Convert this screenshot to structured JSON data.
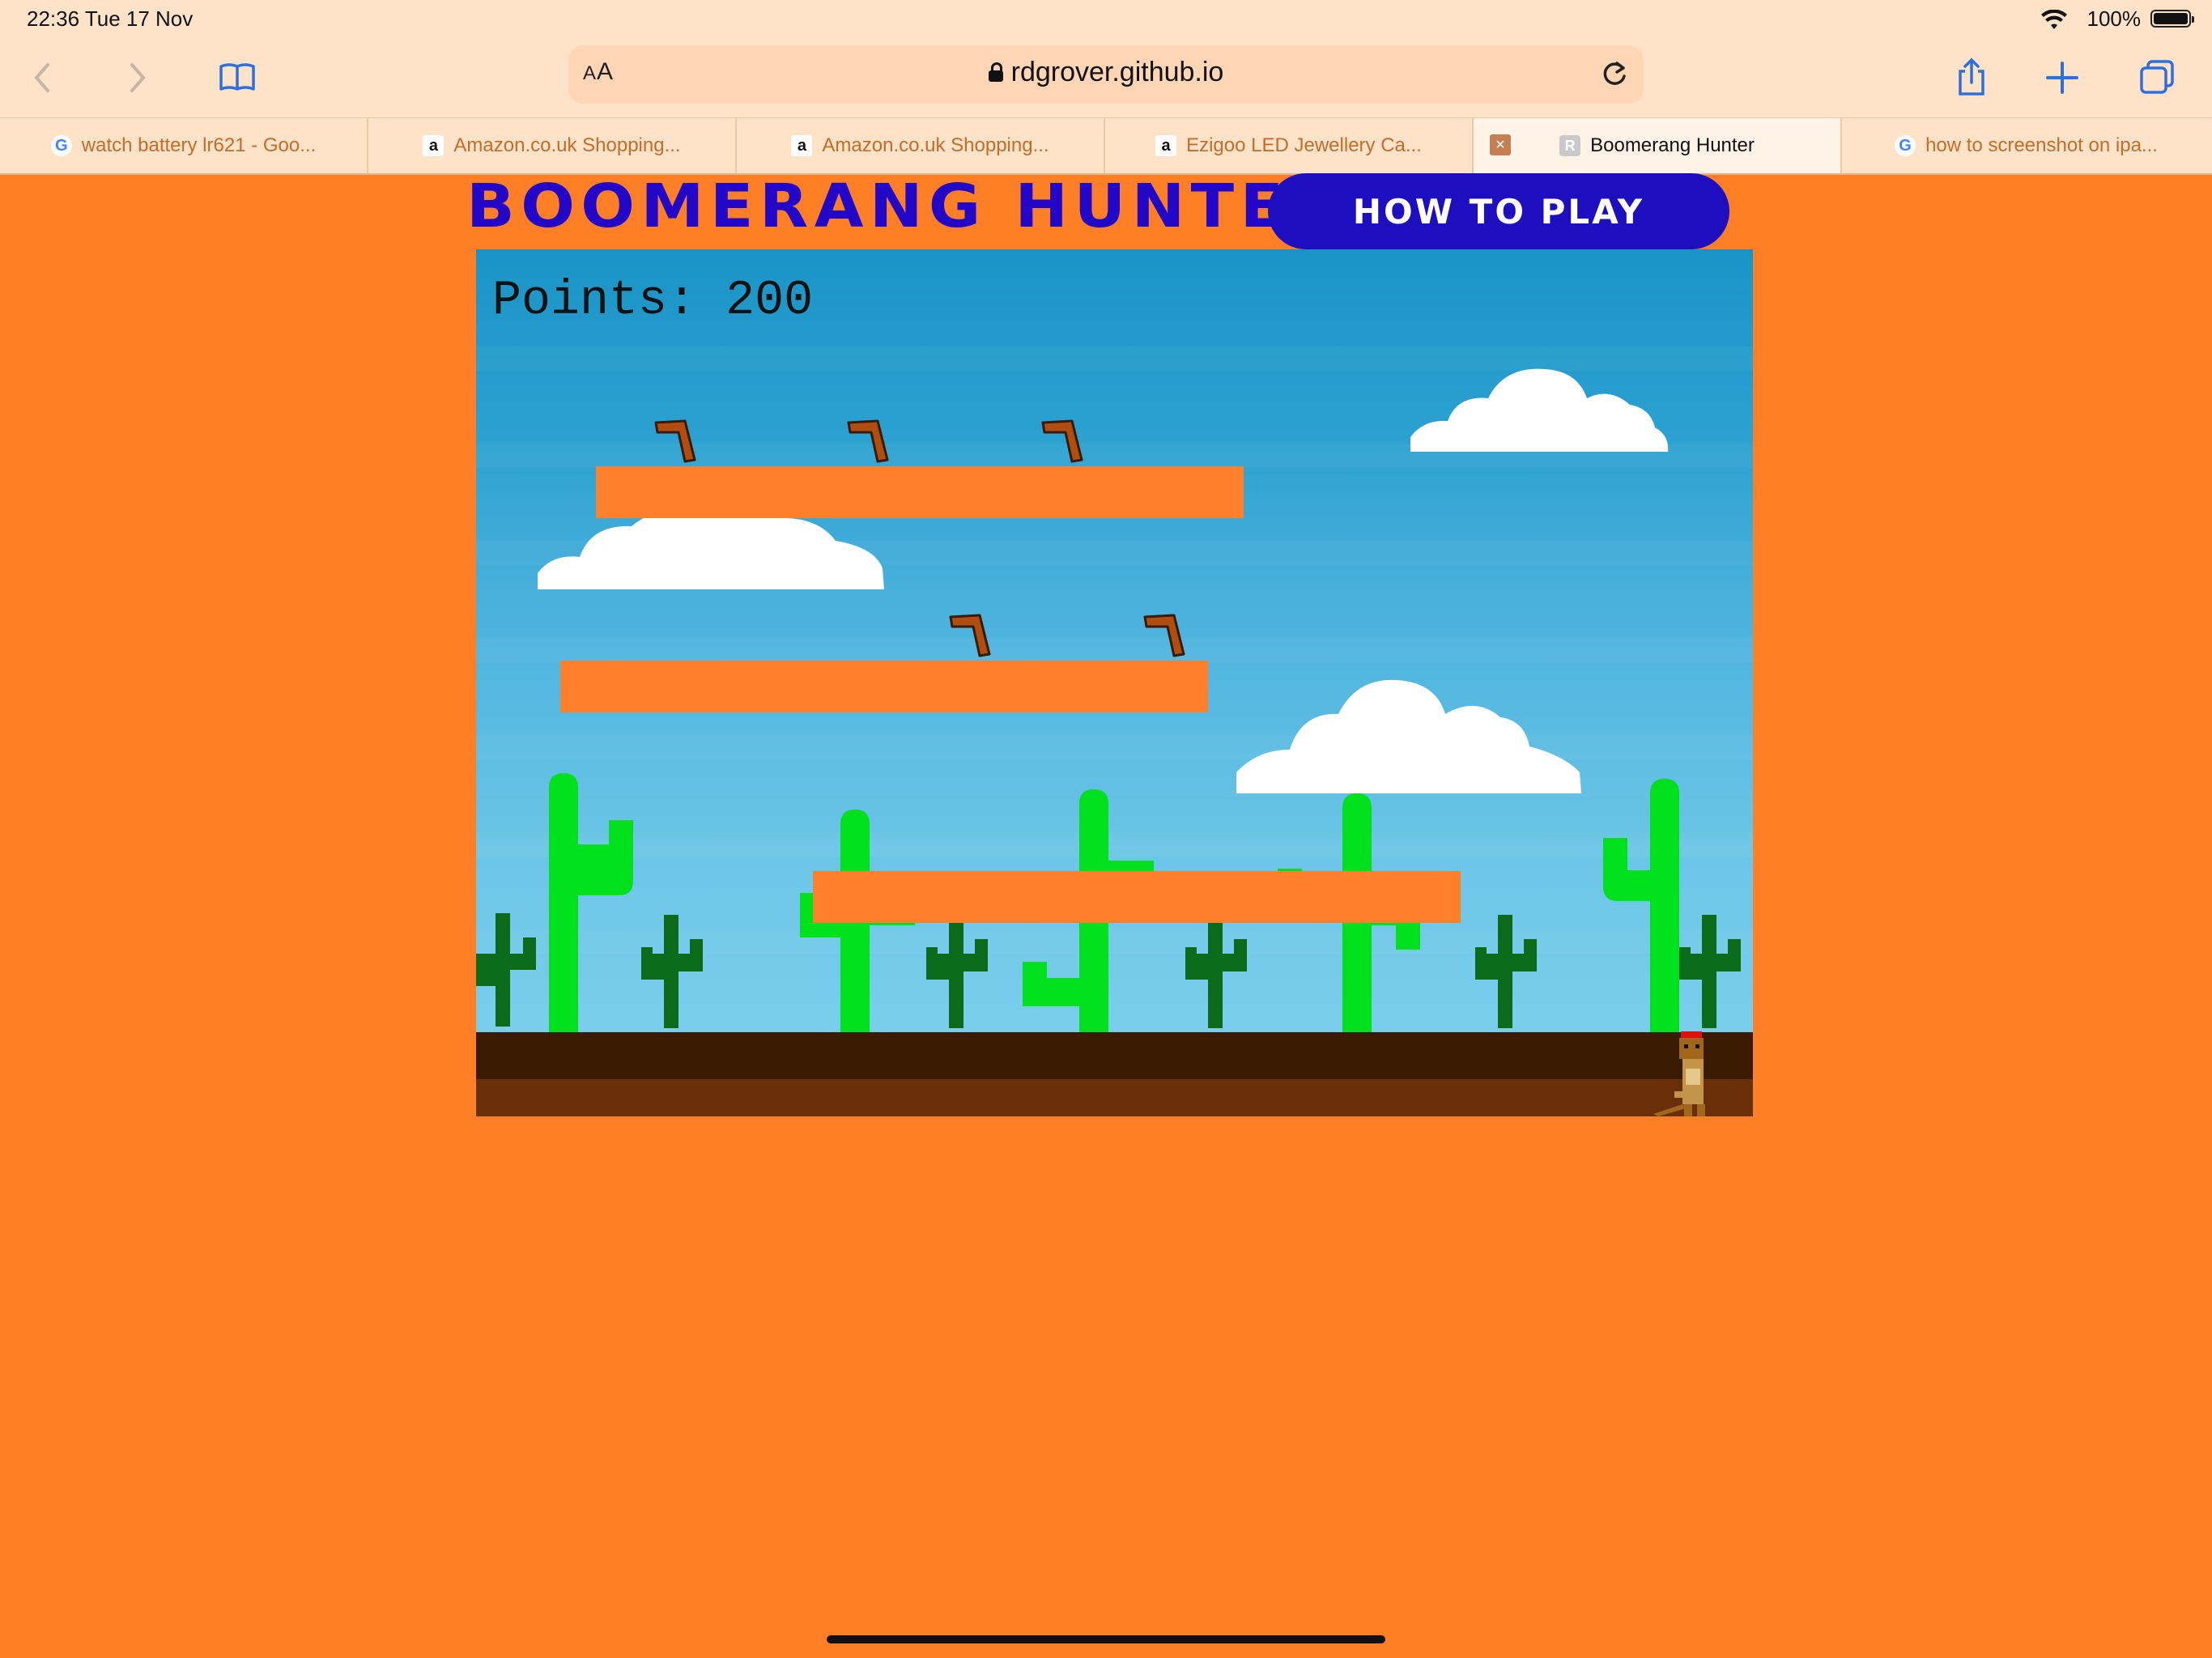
{
  "status_bar": {
    "time": "22:36   Tue 17 Nov",
    "battery": "100%"
  },
  "browser": {
    "text_size_label": "AA",
    "host": "rdgrover.github.io",
    "tabs": [
      {
        "title": "watch battery lr621 - Goo...",
        "favicon": "G"
      },
      {
        "title": "Amazon.co.uk Shopping...",
        "favicon": "a"
      },
      {
        "title": "Amazon.co.uk Shopping...",
        "favicon": "a"
      },
      {
        "title": "Ezigoo LED Jewellery Ca...",
        "favicon": "a"
      },
      {
        "title": "Boomerang Hunter",
        "favicon": "R",
        "active": true
      },
      {
        "title": "how to screenshot on ipa...",
        "favicon": "G"
      }
    ],
    "icons": [
      "back-icon",
      "forward-icon",
      "bookmarks-icon",
      "share-icon",
      "new-tab-icon",
      "tabs-overview-icon",
      "reload-icon",
      "lock-icon"
    ]
  },
  "page": {
    "title": "BOOMERANG HUNTER",
    "how_to_play": "HOW TO PLAY",
    "title_color": "#2207c9",
    "button_color": "#1d0fbf",
    "background_color": "#ff7f27"
  },
  "game": {
    "points_label": "Points:",
    "points_value": "200",
    "platform_color": "#ff7f2a",
    "platforms": 3,
    "boomerangs_remaining": 5,
    "cactus_color": "#00e01d",
    "small_cactus_color": "#0a6b1a"
  }
}
